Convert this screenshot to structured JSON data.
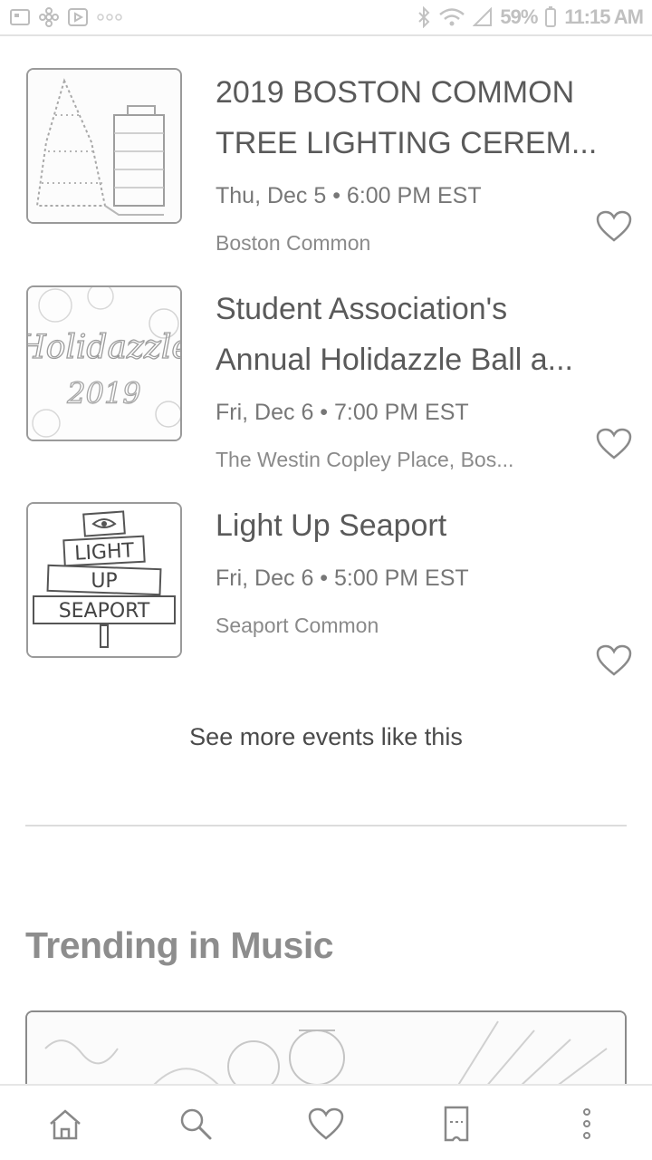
{
  "status_bar": {
    "battery": "59%",
    "time": "11:15 AM",
    "icons": [
      "gallery-icon",
      "flower-icon",
      "play-store-icon",
      "more-dots-icon",
      "bluetooth-icon",
      "wifi-icon",
      "signal-icon",
      "battery-icon"
    ]
  },
  "events": [
    {
      "title_line1": "2019 BOSTON COMMON",
      "title_line2": "TREE LIGHTING CEREM...",
      "date": "Thu, Dec 5 • 6:00 PM EST",
      "venue": "Boston Common",
      "image": "tree-photo"
    },
    {
      "title_line1": "Student Association's",
      "title_line2": "Annual Holidazzle Ball a...",
      "date": "Fri, Dec 6 • 7:00 PM EST",
      "venue": "The Westin Copley Place, Bos...",
      "image": "holidazzle-logo",
      "image_text_1": "Holidazzle",
      "image_text_2": "2019"
    },
    {
      "title_line1": "Light Up Seaport",
      "title_line2": "",
      "date": "Fri, Dec 6 • 5:00 PM EST",
      "venue": "Seaport Common",
      "image": "light-up-seaport-logo",
      "image_text_1": "LIGHT",
      "image_text_2": "UP",
      "image_text_3": "SEAPORT"
    }
  ],
  "see_more": "See more events like this",
  "trending": {
    "title": "Trending in Music"
  },
  "bottom_nav": {
    "items": [
      "home-icon",
      "search-icon",
      "heart-icon",
      "tickets-icon",
      "more-vertical-icon"
    ]
  },
  "colors": {
    "text_primary": "#5a5a5a",
    "text_secondary": "#8a8a8a",
    "border": "#9a9a9a"
  }
}
